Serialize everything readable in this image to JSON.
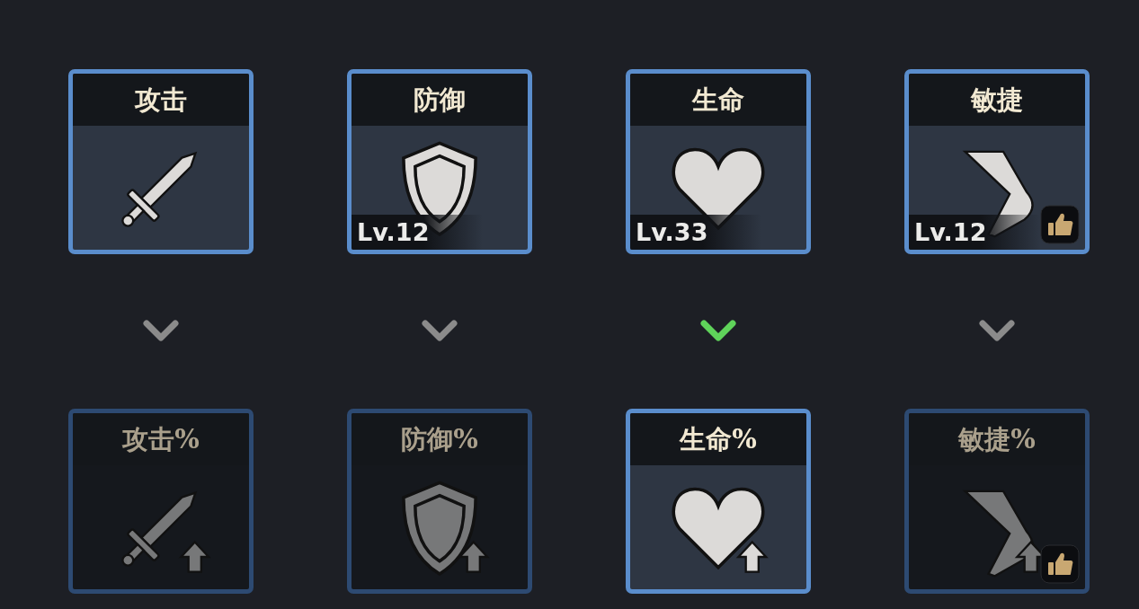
{
  "top_row": [
    {
      "label": "攻击",
      "kind": "sword",
      "selected": true
    },
    {
      "label": "防御",
      "kind": "shield",
      "selected": true,
      "level_text": "Lv.12"
    },
    {
      "label": "生命",
      "kind": "heart",
      "selected": true,
      "level_text": "Lv.33"
    },
    {
      "label": "敏捷",
      "kind": "boot",
      "selected": true,
      "level_text": "Lv.12",
      "recommended": true
    }
  ],
  "connectors": [
    {
      "selected": false
    },
    {
      "selected": false
    },
    {
      "selected": true
    },
    {
      "selected": false
    }
  ],
  "bottom_row": [
    {
      "label": "攻击%",
      "kind": "sword",
      "selected": false
    },
    {
      "label": "防御%",
      "kind": "shield",
      "selected": false
    },
    {
      "label": "生命%",
      "kind": "heart",
      "selected": true
    },
    {
      "label": "敏捷%",
      "kind": "boot",
      "selected": false,
      "recommended": true
    }
  ]
}
